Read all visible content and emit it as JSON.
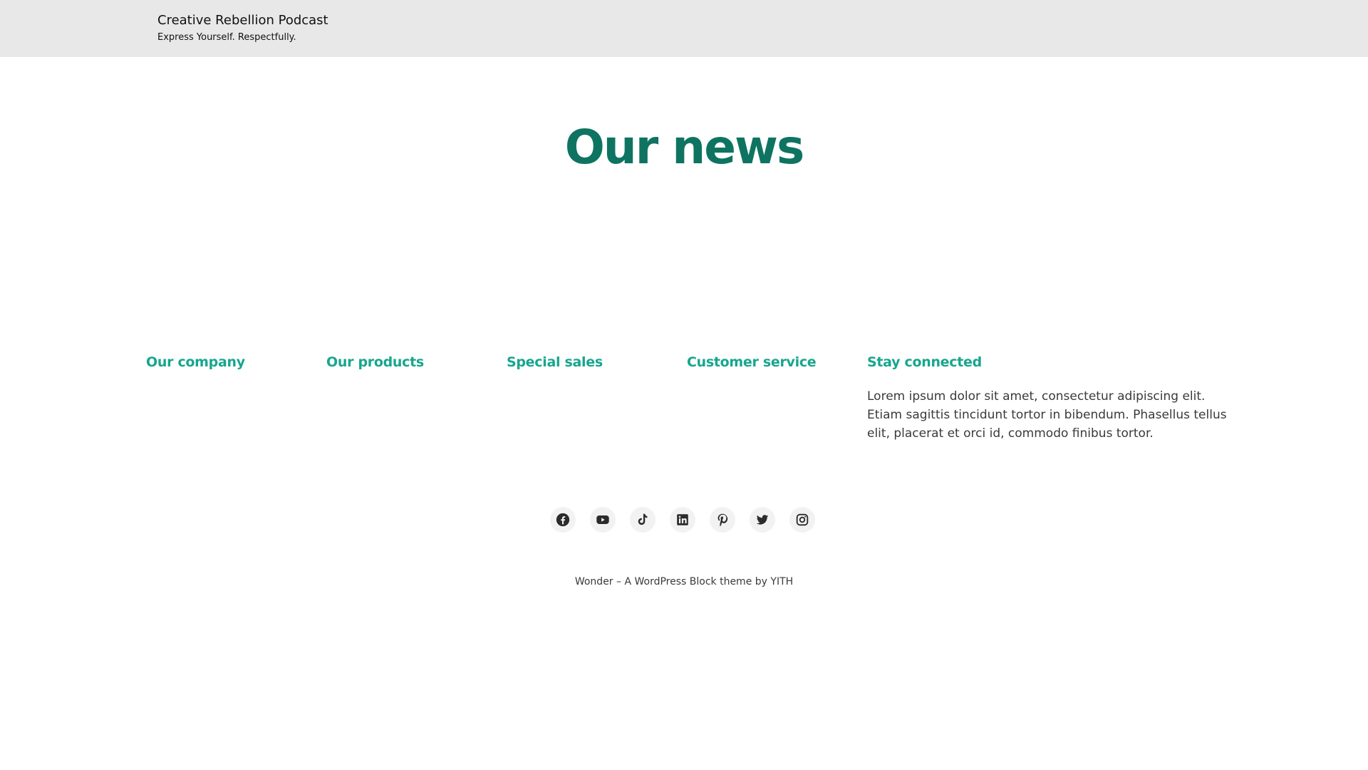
{
  "header": {
    "site_title": "Creative Rebellion Podcast",
    "tagline": "Express Yourself. Respectfully.",
    "background": "#e8e8e8"
  },
  "main": {
    "page_title": "Our news",
    "title_color": "#0e7461"
  },
  "footer": {
    "heading_color": "#17a68e",
    "columns": [
      {
        "heading": "Our company"
      },
      {
        "heading": "Our products"
      },
      {
        "heading": "Special sales"
      },
      {
        "heading": "Customer service"
      },
      {
        "heading": "Stay connected"
      }
    ],
    "stay_connected_text": "Lorem ipsum dolor sit amet, consectetur adipiscing elit. Etiam sagittis tincidunt tortor in bibendum. Phasellus tellus elit, placerat et orci id, commodo finibus tortor.",
    "social_icons": [
      "facebook-icon",
      "youtube-icon",
      "tiktok-icon",
      "linkedin-icon",
      "pinterest-icon",
      "twitter-icon",
      "instagram-icon"
    ],
    "credits": {
      "theme_text": "Wonder – A WordPress Block theme",
      "by_text": "by",
      "author": "YITH"
    }
  }
}
